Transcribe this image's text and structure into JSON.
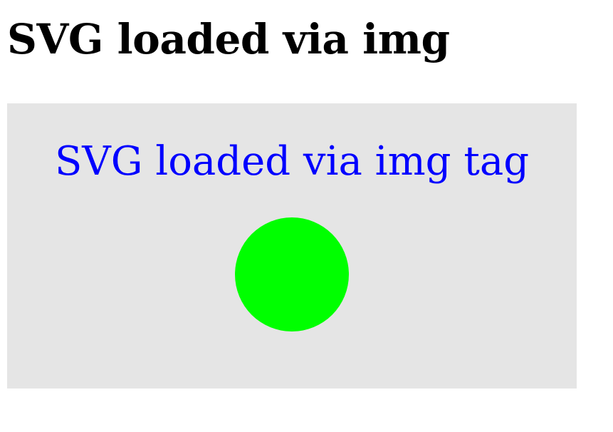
{
  "page": {
    "heading": "SVG loaded via img"
  },
  "svg_image": {
    "caption": "SVG loaded via img tag",
    "colors": {
      "background": "#e5e5e5",
      "caption": "#0000ff",
      "circle": "#00ff00"
    },
    "shapes": [
      "circle"
    ]
  }
}
